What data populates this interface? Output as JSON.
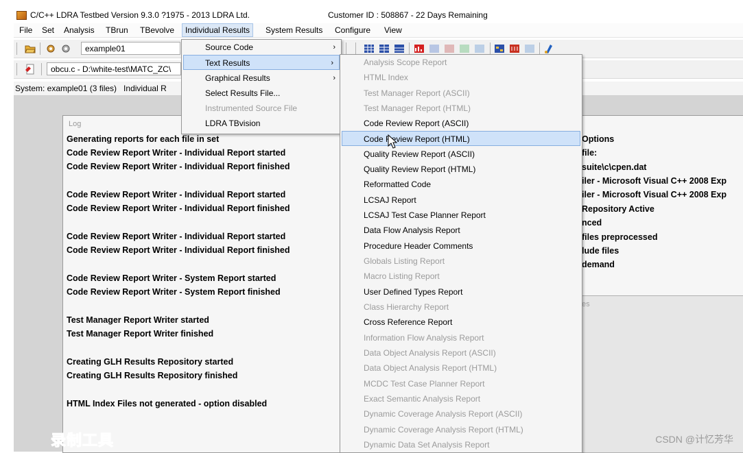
{
  "window": {
    "title": "C/C++ LDRA Testbed Version 9.3.0 ?1975 - 2013 LDRA Ltd.",
    "customer": "Customer ID : 508867 - 22 Days Remaining"
  },
  "menubar": [
    "File",
    "Set",
    "Analysis",
    "TBrun",
    "TBevolve",
    "Individual Results",
    "System Results",
    "Configure",
    "View"
  ],
  "toolbar1": {
    "set_combo_value": "example01"
  },
  "toolbar2": {
    "file_combo_value": "obcu.c - D:\\white-test\\MATC_ZC\\"
  },
  "system_line": "System: example01 (3 files)   Individual R",
  "individual_results_menu": [
    {
      "label": "Source Code",
      "submenu": true,
      "enabled": true
    },
    {
      "label": "Text Results",
      "submenu": true,
      "enabled": true,
      "highlighted": true
    },
    {
      "label": "Graphical Results",
      "submenu": true,
      "enabled": true
    },
    {
      "label": "Select Results File...",
      "submenu": false,
      "enabled": true
    },
    {
      "label": "Instrumented Source File",
      "submenu": false,
      "enabled": false
    },
    {
      "label": "LDRA TBvision",
      "submenu": false,
      "enabled": true
    }
  ],
  "text_results_menu": [
    {
      "label": "Analysis Scope Report",
      "enabled": false
    },
    {
      "label": "HTML Index",
      "enabled": false
    },
    {
      "label": "Test Manager Report (ASCII)",
      "enabled": false
    },
    {
      "label": "Test Manager Report (HTML)",
      "enabled": false
    },
    {
      "label": "Code Review Report (ASCII)",
      "enabled": true
    },
    {
      "label": "Code Review Report (HTML)",
      "enabled": true,
      "highlighted": true
    },
    {
      "label": "Quality Review Report (ASCII)",
      "enabled": true
    },
    {
      "label": "Quality Review Report (HTML)",
      "enabled": true
    },
    {
      "label": "Reformatted Code",
      "enabled": true
    },
    {
      "label": "LCSAJ Report",
      "enabled": true
    },
    {
      "label": "LCSAJ Test Case Planner Report",
      "enabled": true
    },
    {
      "label": "Data Flow Analysis Report",
      "enabled": true
    },
    {
      "label": "Procedure Header Comments",
      "enabled": true
    },
    {
      "label": "Globals Listing Report",
      "enabled": false
    },
    {
      "label": "Macro Listing Report",
      "enabled": false
    },
    {
      "label": "User Defined Types Report",
      "enabled": true
    },
    {
      "label": "Class Hierarchy Report",
      "enabled": false
    },
    {
      "label": "Cross Reference Report",
      "enabled": true
    },
    {
      "label": "Information Flow Analysis Report",
      "enabled": false
    },
    {
      "label": "Data Object Analysis Report (ASCII)",
      "enabled": false
    },
    {
      "label": "Data Object Analysis Report (HTML)",
      "enabled": false
    },
    {
      "label": "MCDC Test Case Planner Report",
      "enabled": false
    },
    {
      "label": "Exact Semantic Analysis Report",
      "enabled": false
    },
    {
      "label": "Dynamic Coverage Analysis Report (ASCII)",
      "enabled": false
    },
    {
      "label": "Dynamic Coverage Analysis Report (HTML)",
      "enabled": false
    },
    {
      "label": "Dynamic Data Set Analysis Report",
      "enabled": false
    }
  ],
  "log": {
    "caption": "Log",
    "lines": [
      "Generating reports for each file in set",
      "Code Review Report Writer - Individual Report started",
      "Code Review Report Writer - Individual Report finished",
      "",
      "Code Review Report Writer - Individual Report started",
      "Code Review Report Writer - Individual Report finished",
      "",
      "Code Review Report Writer - Individual Report started",
      "Code Review Report Writer - Individual Report finished",
      "",
      "Code Review Report Writer - System Report started",
      "Code Review Report Writer - System Report finished",
      "",
      "Test Manager Report Writer started",
      "Test Manager Report Writer finished",
      "",
      "Creating GLH Results Repository started",
      "Creating GLH Results Repository finished",
      "",
      "HTML Index Files not generated - option disabled"
    ]
  },
  "options_panel": {
    "lines": [
      "Options",
      "file:",
      "suite\\c\\cpen.dat",
      "iler - Microsoft Visual C++ 2008 Exp",
      "iler - Microsoft Visual C++ 2008 Exp",
      "Repository Active",
      "nced",
      "files preprocessed",
      "lude files",
      "demand"
    ],
    "lower_caption": "es"
  },
  "watermark": "CSDN @计忆芳华",
  "overlay_text": "录制工具"
}
